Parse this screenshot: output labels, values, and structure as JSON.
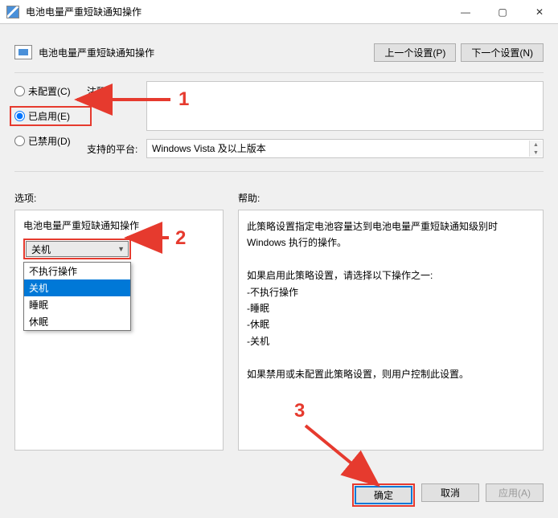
{
  "title": "电池电量严重短缺通知操作",
  "header": {
    "title": "电池电量严重短缺通知操作",
    "prev": "上一个设置(P)",
    "next": "下一个设置(N)"
  },
  "radios": {
    "unconfigured": "未配置(C)",
    "enabled": "已启用(E)",
    "disabled": "已禁用(D)"
  },
  "fields": {
    "comment_label": "注释:",
    "comment_value": "",
    "platform_label": "支持的平台:",
    "platform_value": "Windows Vista 及以上版本"
  },
  "section_labels": {
    "options": "选项:",
    "help": "帮助:"
  },
  "options_panel": {
    "caption": "电池电量严重短缺通知操作",
    "selected": "关机",
    "items": [
      "不执行操作",
      "关机",
      "睡眠",
      "休眠"
    ]
  },
  "help_lines": [
    "此策略设置指定电池容量达到电池电量严重短缺通知级别时 Windows 执行的操作。",
    "",
    "如果启用此策略设置，请选择以下操作之一:",
    "-不执行操作",
    "-睡眠",
    "-休眠",
    "-关机",
    "",
    "如果禁用或未配置此策略设置，则用户控制此设置。"
  ],
  "buttons": {
    "ok": "确定",
    "cancel": "取消",
    "apply": "应用(A)"
  },
  "annotations": {
    "a1": "1",
    "a2": "2",
    "a3": "3"
  }
}
